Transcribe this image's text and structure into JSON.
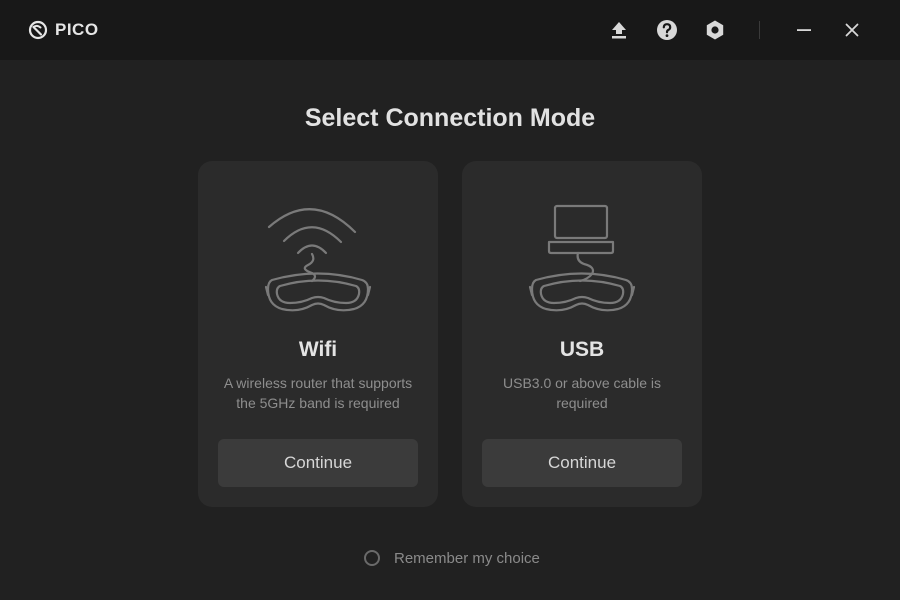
{
  "app": {
    "brand": "PICO",
    "toolbar": {
      "upload_icon": "upload-icon",
      "help_icon": "help-icon",
      "settings_icon": "settings-icon",
      "minimize_icon": "minimize-icon",
      "close_icon": "close-icon"
    }
  },
  "main": {
    "title": "Select Connection Mode",
    "cards": [
      {
        "icon": "wifi-headset-icon",
        "title": "Wifi",
        "description": "A wireless router that supports the 5GHz band is required",
        "button": "Continue"
      },
      {
        "icon": "usb-headset-icon",
        "title": "USB",
        "description": "USB3.0 or above cable is required",
        "button": "Continue"
      }
    ],
    "remember": {
      "label": "Remember my choice",
      "checked": false
    }
  },
  "colors": {
    "background": "#212121",
    "titlebar": "#181818",
    "card": "#2b2b2b",
    "button": "#3b3b3b",
    "title_text": "#e2e2e2",
    "muted_text": "#8e8e8e"
  }
}
